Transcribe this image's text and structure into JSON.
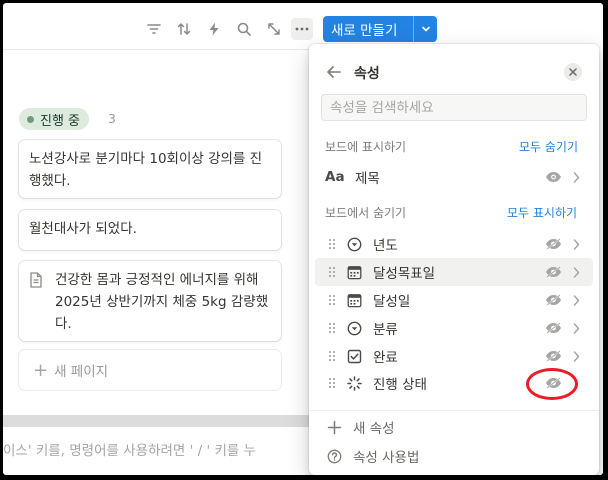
{
  "toolbar": {
    "icons": [
      "filter-icon",
      "sort-icon",
      "automation-bolt-icon",
      "search-icon",
      "expand-icon",
      "more-icon"
    ],
    "new_button_label": "새로 만들기"
  },
  "board": {
    "status_label": "진행 중",
    "count": "3",
    "cards": [
      {
        "text": "노션강사로 분기마다 10회이상 강의를 진행했다."
      },
      {
        "text": "월천대사가 되었다."
      },
      {
        "text": "건강한 몸과 긍정적인 에너지를 위해 2025년 상반기까지 체중 5kg 감량했다."
      }
    ],
    "new_page_label": "새 페이지",
    "hint_text": "이스' 키를, 명령어를 사용하려면 ' / ' 키를 누"
  },
  "properties_panel": {
    "title": "속성",
    "search_placeholder": "속성을 검색하세요",
    "shown_section_label": "보드에 표시하기",
    "hide_all_label": "모두 숨기기",
    "shown_items": [
      {
        "icon": "Aa",
        "label": "제목"
      }
    ],
    "hidden_section_label": "보드에서 숨기기",
    "show_all_label": "모두 표시하기",
    "hidden_items": [
      {
        "icon": "select-icon",
        "label": "년도"
      },
      {
        "icon": "calendar-icon",
        "label": "달성목표일"
      },
      {
        "icon": "calendar-icon",
        "label": "달성일"
      },
      {
        "icon": "select-icon",
        "label": "분류"
      },
      {
        "icon": "checkbox-icon",
        "label": "완료"
      },
      {
        "icon": "status-icon",
        "label": "진행 상태"
      }
    ],
    "new_property_label": "새 속성",
    "help_label": "속성 사용법"
  },
  "colors": {
    "accent": "#2383e2",
    "status_tag_bg": "#dcebdd",
    "annotation_ring": "#e81c2a"
  }
}
